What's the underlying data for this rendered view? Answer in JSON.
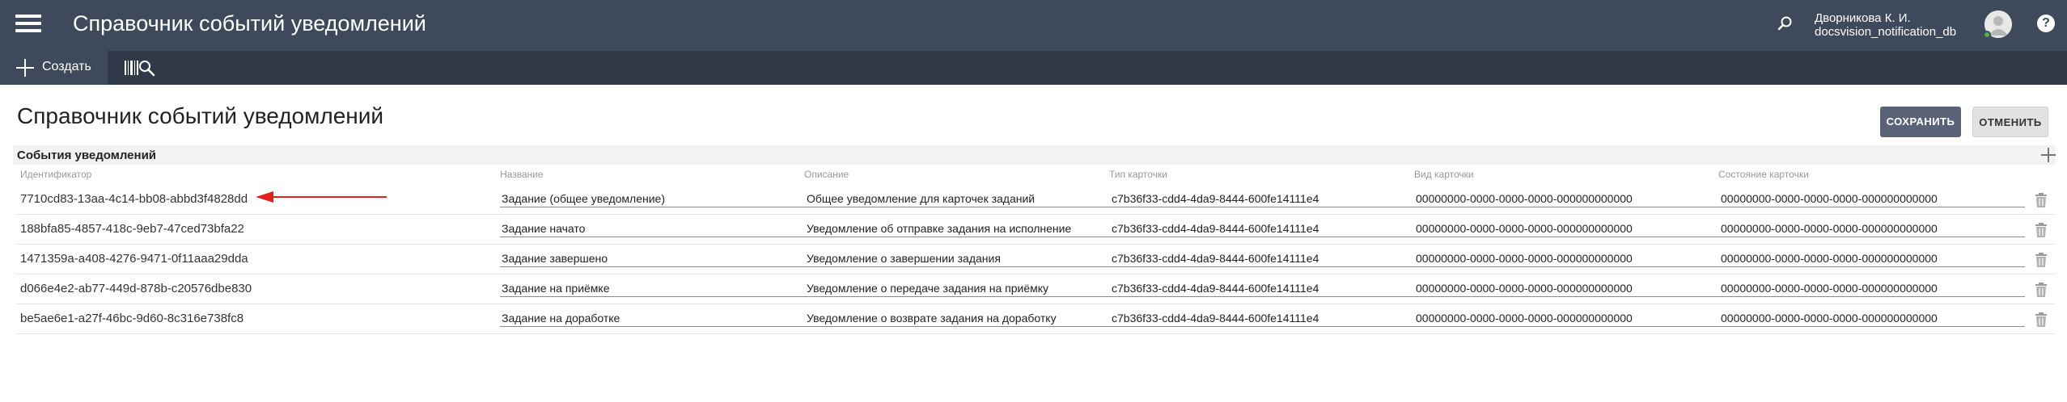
{
  "header": {
    "title": "Справочник событий уведомлений",
    "user_name": "Дворникова К. И.",
    "database": "docsvision_notification_db",
    "icons": [
      "menu-icon",
      "search-icon",
      "avatar-icon",
      "help-icon"
    ],
    "help_label": "?"
  },
  "toolbar": {
    "create_label": "Создать",
    "icons": [
      "plus-icon",
      "barcode-search-icon"
    ]
  },
  "page": {
    "title": "Справочник событий уведомлений",
    "save_label": "СОХРАНИТЬ",
    "cancel_label": "ОТМЕНИТЬ"
  },
  "section": {
    "title": "События уведомлений"
  },
  "table": {
    "columns": [
      "Идентификатор",
      "Название",
      "Описание",
      "Тип карточки",
      "Вид карточки",
      "Состояние карточки"
    ],
    "rows": [
      {
        "id": "7710cd83-13aa-4c14-bb08-abbd3f4828dd",
        "name": "Задание (общее уведомление)",
        "description": "Общее уведомление для карточек заданий",
        "card_type": "c7b36f33-cdd4-4da9-8444-600fe14111e4",
        "card_kind": "00000000-0000-0000-0000-000000000000",
        "card_state": "00000000-0000-0000-0000-000000000000"
      },
      {
        "id": "188bfa85-4857-418c-9eb7-47ced73bfa22",
        "name": "Задание начато",
        "description": "Уведомление об отправке задания на исполнение",
        "card_type": "c7b36f33-cdd4-4da9-8444-600fe14111e4",
        "card_kind": "00000000-0000-0000-0000-000000000000",
        "card_state": "00000000-0000-0000-0000-000000000000"
      },
      {
        "id": "1471359a-a408-4276-9471-0f11aaa29dda",
        "name": "Задание завершено",
        "description": "Уведомление о завершении задания",
        "card_type": "c7b36f33-cdd4-4da9-8444-600fe14111e4",
        "card_kind": "00000000-0000-0000-0000-000000000000",
        "card_state": "00000000-0000-0000-0000-000000000000"
      },
      {
        "id": "d066e4e2-ab77-449d-878b-c20576dbe830",
        "name": "Задание на приёмке",
        "description": "Уведомление о передаче задания на приёмку",
        "card_type": "c7b36f33-cdd4-4da9-8444-600fe14111e4",
        "card_kind": "00000000-0000-0000-0000-000000000000",
        "card_state": "00000000-0000-0000-0000-000000000000"
      },
      {
        "id": "be5ae6e1-a27f-46bc-9d60-8c316e738fc8",
        "name": "Задание на доработке",
        "description": "Уведомление о возврате задания на доработку",
        "card_type": "c7b36f33-cdd4-4da9-8444-600fe14111e4",
        "card_kind": "00000000-0000-0000-0000-000000000000",
        "card_state": "00000000-0000-0000-0000-000000000000"
      }
    ]
  },
  "colors": {
    "appbar": "#3e4a5c",
    "toolbar": "#2f3947",
    "save_button": "#5a6278",
    "annotation_arrow": "#e0201b"
  }
}
